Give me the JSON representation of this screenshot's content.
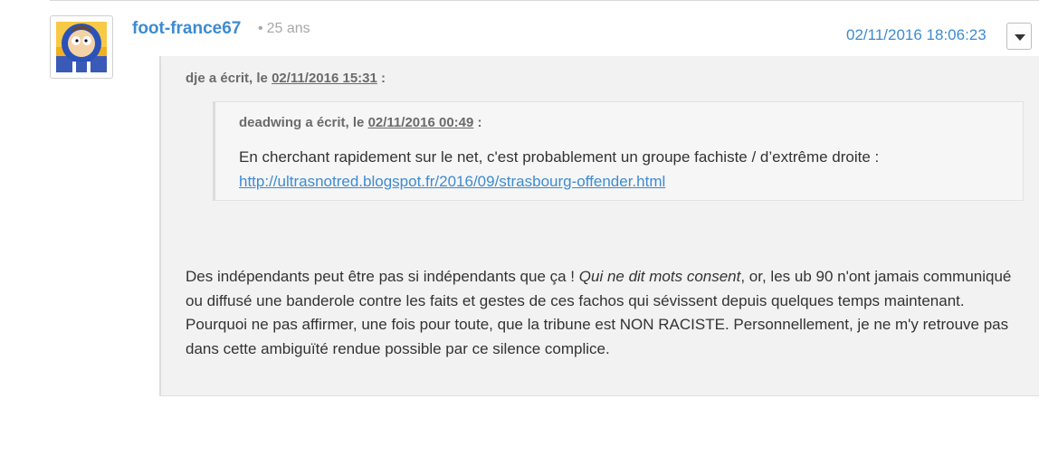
{
  "post": {
    "author": "foot-france67",
    "age_separator": "•",
    "age": "25 ans",
    "datetime": "02/11/2016 18:06:23",
    "menu_icon": "chevron-down-icon",
    "avatar_icon": "cartoon-hooded-character-avatar",
    "colors": {
      "link": "#3d8bd1",
      "quote_bg": "#f2f2f2",
      "muted": "#a8a8a8"
    }
  },
  "quote_outer": {
    "author_prefix": "dje a écrit, le",
    "date": "02/11/2016 15:31",
    "suffix": ":"
  },
  "quote_inner": {
    "author_prefix": "deadwing a écrit, le",
    "date": "02/11/2016 00:49",
    "suffix": ":",
    "text": "En cherchant rapidement sur le net, c'est probablement un groupe fachiste / d’extrême droite :",
    "link": "http://ultrasnotred.blogspot.fr/2016/09/strasbourg-offender.html"
  },
  "message": {
    "part1": "Des indépendants peut être pas si indépendants que ça ! ",
    "italic": "Qui ne dit mots consent",
    "part2": ", or, les ub 90 n'ont jamais communiqué ou diffusé une banderole contre les faits et gestes de ces fachos qui sévissent depuis quelques temps maintenant. Pourquoi ne pas affirmer, une fois pour toute, que la tribune est NON RACISTE. Personnellement, je ne m'y retrouve pas dans cette ambiguïté rendue possible par ce silence complice."
  }
}
